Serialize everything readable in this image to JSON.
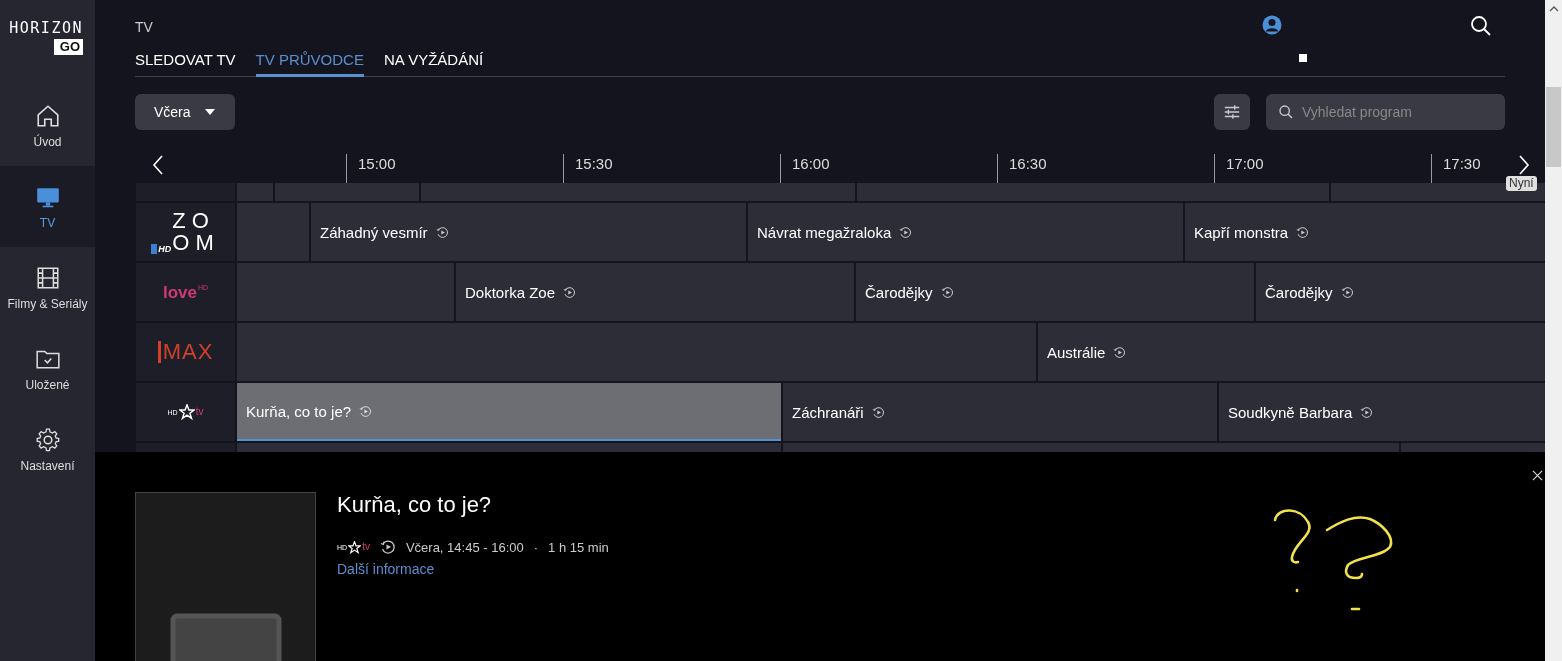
{
  "brand": {
    "name": "HORIZON",
    "badge": "GO"
  },
  "sidebar": {
    "items": [
      {
        "kind": "home",
        "label": "Úvod",
        "selected": false
      },
      {
        "kind": "tv",
        "label": "TV",
        "selected": true
      },
      {
        "kind": "film",
        "label": "Filmy & Seriály",
        "selected": false
      },
      {
        "kind": "saved",
        "label": "Uložené",
        "selected": false
      },
      {
        "kind": "settings",
        "label": "Nastavení",
        "selected": false
      }
    ]
  },
  "breadcrumb": "TV",
  "tabs": [
    {
      "label": "SLEDOVAT TV",
      "selected": false
    },
    {
      "label": "TV PRŮVODCE",
      "selected": true
    },
    {
      "label": "NA VYŽÁDÁNÍ",
      "selected": false
    }
  ],
  "day_select": {
    "value": "Včera"
  },
  "search": {
    "placeholder": "Vyhledat program"
  },
  "timeline": {
    "times": [
      "15:00",
      "15:30",
      "16:00",
      "16:30",
      "17:00",
      "17:30"
    ],
    "now_label": "Nyní"
  },
  "channels": [
    {
      "kind": "zoom",
      "logo": [
        "ZO",
        "OM"
      ],
      "badge": "HD",
      "programs": [
        {
          "title": "Záhadný vesmír",
          "selected": false
        },
        {
          "title": "Návrat megažraloka",
          "selected": false
        },
        {
          "title": "Kapří monstra",
          "selected": false
        }
      ]
    },
    {
      "kind": "love",
      "logo": [
        "love"
      ],
      "badge": "HD",
      "programs": [
        {
          "title": "Doktorka Zoe",
          "selected": false
        },
        {
          "title": "Čarodějky",
          "selected": false
        },
        {
          "title": "Čarodějky",
          "selected": false
        }
      ]
    },
    {
      "kind": "max",
      "logo": [
        "MAX"
      ],
      "programs": [
        {
          "title": "Austrálie",
          "selected": false
        }
      ]
    },
    {
      "kind": "barrandov",
      "logo": [
        "tv"
      ],
      "badge": "HD",
      "programs": [
        {
          "title": "Kurňa, co to je?",
          "selected": true
        },
        {
          "title": "Záchranáři",
          "selected": false
        },
        {
          "title": "Soudkyně Barbara",
          "selected": false
        }
      ]
    }
  ],
  "detail": {
    "title": "Kurňa, co to je?",
    "channel": {
      "kind": "barrandov",
      "logo": [
        "tv"
      ],
      "badge": "HD"
    },
    "time": "Včera, 14:45 - 16:00",
    "separator": "·",
    "duration": "1 h 15 min",
    "link": "Další informace"
  }
}
